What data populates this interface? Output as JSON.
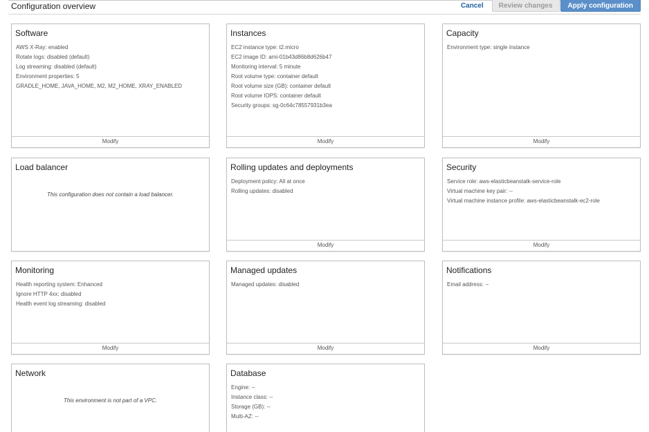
{
  "header": {
    "title": "Configuration overview",
    "cancel_label": "Cancel",
    "review_label": "Review changes",
    "apply_label": "Apply configuration"
  },
  "modify_label": "Modify",
  "cards": {
    "software": {
      "title": "Software",
      "lines": [
        "AWS X-Ray: enabled",
        "Rotate logs: disabled (default)",
        "Log streaming: disabled (default)",
        "Environment properties: 5",
        "GRADLE_HOME, JAVA_HOME, M2, M2_HOME, XRAY_ENABLED"
      ]
    },
    "instances": {
      "title": "Instances",
      "lines": [
        "EC2 instance type: t2.micro",
        "EC2 image ID: ami-01b43d86b8d626b47",
        "Monitoring interval: 5 minute",
        "Root volume type: container default",
        "Root volume size (GB): container default",
        "Root volume IOPS: container default",
        "Security groups: sg-0c64c78557931b3ea"
      ]
    },
    "capacity": {
      "title": "Capacity",
      "lines": [
        "Environment type: single instance"
      ]
    },
    "load_balancer": {
      "title": "Load balancer",
      "note": "This configuration does not contain a load balancer."
    },
    "rolling_updates": {
      "title": "Rolling updates and deployments",
      "lines": [
        "Deployment policy: All at once",
        "Rolling updates: disabled"
      ]
    },
    "security": {
      "title": "Security",
      "lines": [
        "Service role: aws-elasticbeanstalk-service-role",
        "Virtual machine key pair: --",
        "Virtual machine instance profile: aws-elasticbeanstalk-ec2-role"
      ]
    },
    "monitoring": {
      "title": "Monitoring",
      "lines": [
        "Health reporting system: Enhanced",
        "Ignore HTTP 4xx: disabled",
        "Health event log streaming: disabled"
      ]
    },
    "managed_updates": {
      "title": "Managed updates",
      "lines": [
        "Managed updates: disabled"
      ]
    },
    "notifications": {
      "title": "Notifications",
      "lines": [
        "Email address: --"
      ]
    },
    "network": {
      "title": "Network",
      "note": "This environment is not part of a VPC."
    },
    "database": {
      "title": "Database",
      "lines": [
        "Engine: --",
        "Instance class: --",
        "Storage (GB): --",
        "Multi-AZ: --"
      ]
    }
  }
}
